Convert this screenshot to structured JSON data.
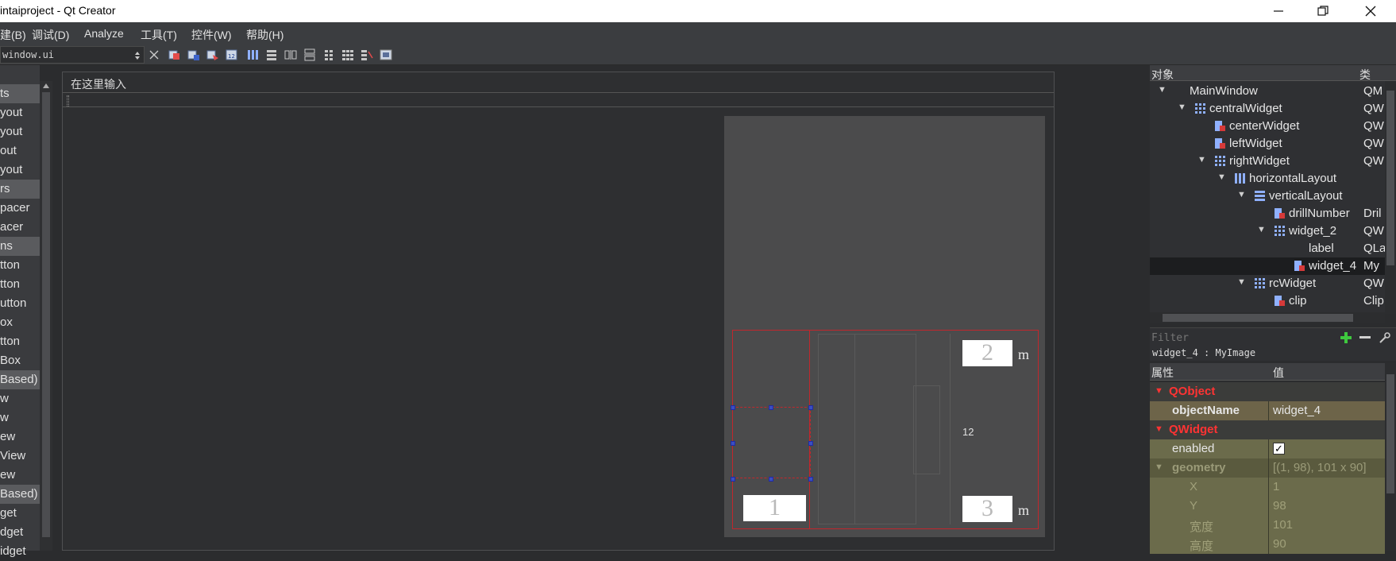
{
  "window": {
    "title": "intaiproject - Qt Creator",
    "minimize_icon": "minimize-icon",
    "maximize_icon": "restore-icon",
    "close_icon": "close-icon"
  },
  "menu": [
    "建(B)",
    "调试(D)",
    "Analyze",
    "工具(T)",
    "控件(W)",
    "帮助(H)"
  ],
  "toolbar": {
    "file_combo": "window.ui",
    "close_icon": "close-icon"
  },
  "widget_box": {
    "rows": [
      {
        "label": "ts",
        "category": true
      },
      {
        "label": "yout",
        "category": false
      },
      {
        "label": "yout",
        "category": false
      },
      {
        "label": "out",
        "category": false
      },
      {
        "label": "yout",
        "category": false
      },
      {
        "label": "rs",
        "category": true
      },
      {
        "label": "pacer",
        "category": false
      },
      {
        "label": "acer",
        "category": false
      },
      {
        "label": "ns",
        "category": true
      },
      {
        "label": "tton",
        "category": false
      },
      {
        "label": "tton",
        "category": false
      },
      {
        "label": "utton",
        "category": false
      },
      {
        "label": "ox",
        "category": false
      },
      {
        "label": "tton",
        "category": false
      },
      {
        "label": "Box",
        "category": false
      },
      {
        "label": "Based)",
        "category": true
      },
      {
        "label": "w",
        "category": false
      },
      {
        "label": "w",
        "category": false
      },
      {
        "label": "ew",
        "category": false
      },
      {
        "label": "View",
        "category": false
      },
      {
        "label": "ew",
        "category": false
      },
      {
        "label": "Based)",
        "category": true
      },
      {
        "label": "get",
        "category": false
      },
      {
        "label": "dget",
        "category": false
      },
      {
        "label": "idget",
        "category": false
      }
    ]
  },
  "form": {
    "menubar_placeholder": "在这里输入",
    "box_1": "1",
    "box_2": "2",
    "box_3": "3",
    "unit_top": "m",
    "unit_bottom": "m",
    "middle_value": "12"
  },
  "object_inspector": {
    "col_object": "对象",
    "col_class": "类",
    "rows": [
      {
        "name": "MainWindow",
        "class": "QM",
        "depth": 0,
        "arrow": "▼",
        "icon": "none",
        "selected": false
      },
      {
        "name": "centralWidget",
        "class": "QW",
        "depth": 1,
        "arrow": "▼",
        "icon": "grid",
        "selected": false
      },
      {
        "name": "centerWidget",
        "class": "QW",
        "depth": 2,
        "arrow": "",
        "icon": "widget",
        "selected": false
      },
      {
        "name": "leftWidget",
        "class": "QW",
        "depth": 2,
        "arrow": "",
        "icon": "widget",
        "selected": false
      },
      {
        "name": "rightWidget",
        "class": "QW",
        "depth": 2,
        "arrow": "▼",
        "icon": "grid",
        "selected": false
      },
      {
        "name": "horizontalLayout",
        "class": "",
        "depth": 3,
        "arrow": "▼",
        "icon": "hlayout",
        "selected": false
      },
      {
        "name": "verticalLayout",
        "class": "",
        "depth": 4,
        "arrow": "▼",
        "icon": "vlayout",
        "selected": false
      },
      {
        "name": "drillNumber",
        "class": "Dril",
        "depth": 5,
        "arrow": "",
        "icon": "widget",
        "selected": false
      },
      {
        "name": "widget_2",
        "class": "QW",
        "depth": 5,
        "arrow": "▼",
        "icon": "grid",
        "selected": false
      },
      {
        "name": "label",
        "class": "QLa",
        "depth": 6,
        "arrow": "",
        "icon": "none",
        "selected": false
      },
      {
        "name": "widget_4",
        "class": "My",
        "depth": 6,
        "arrow": "",
        "icon": "widget",
        "selected": true
      },
      {
        "name": "rcWidget",
        "class": "QW",
        "depth": 4,
        "arrow": "▼",
        "icon": "grid",
        "selected": false
      },
      {
        "name": "clip",
        "class": "Clip",
        "depth": 5,
        "arrow": "",
        "icon": "widget",
        "selected": false
      }
    ]
  },
  "filter": {
    "placeholder": "Filter",
    "add_icon": "plus-icon",
    "remove_icon": "minus-icon",
    "tool_icon": "wrench-icon"
  },
  "current_object": "widget_4 : MyImage",
  "property_editor": {
    "col_property": "属性",
    "col_value": "值",
    "rows": [
      {
        "name": "QObject",
        "value": "",
        "kind": "group"
      },
      {
        "name": "objectName",
        "value": "widget_4",
        "kind": "bold"
      },
      {
        "name": "QWidget",
        "value": "",
        "kind": "group"
      },
      {
        "name": "enabled",
        "value": "✓",
        "kind": "check"
      },
      {
        "name": "geometry",
        "value": "[(1, 98), 101 x 90]",
        "kind": "dim-bold"
      },
      {
        "name": "X",
        "value": "1",
        "kind": "dim"
      },
      {
        "name": "Y",
        "value": "98",
        "kind": "dim"
      },
      {
        "name": "宽度",
        "value": "101",
        "kind": "dim"
      },
      {
        "name": "高度",
        "value": "90",
        "kind": "dim"
      }
    ]
  },
  "colors": {
    "group_red": "#ff3333",
    "prop_bg_light": "#6b6b4b",
    "prop_bg_dark": "#5a5a3e",
    "selection_red": "#c1272d",
    "handle_blue": "#3a4fc0"
  }
}
